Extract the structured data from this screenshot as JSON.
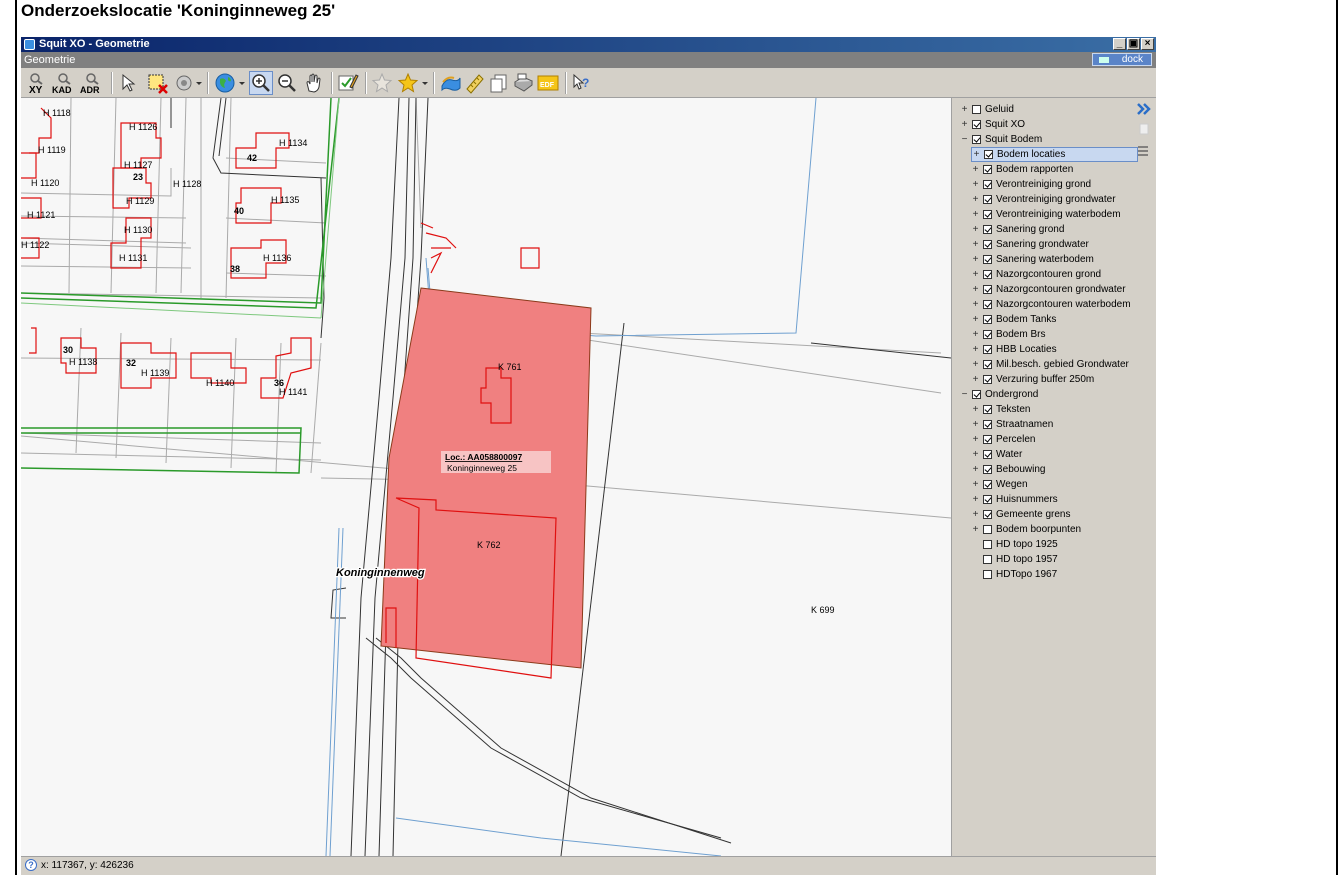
{
  "page": {
    "heading": "Onderzoekslocatie 'Koninginneweg 25'"
  },
  "window": {
    "title": "Squit XO - Geometrie",
    "subtitle": "Geometrie",
    "dock_label": "dock",
    "controls": [
      "_",
      "&#9633;",
      "X"
    ]
  },
  "toolbar": {
    "xy": "XY",
    "kad": "KAD",
    "adr": "ADR",
    "edf": "EDF"
  },
  "map": {
    "labels": {
      "h1118": "H 1118",
      "h1126": "H 1126",
      "h1119": "H 1119",
      "h1127": "H 1127",
      "h1120": "H 1120",
      "h1128": "H 1128",
      "h1129": "H 1129",
      "h1121": "H 1121",
      "h1130": "H 1130",
      "h1122": "H 1122",
      "h1131": "H 1131",
      "h1134": "H 1134",
      "h1135": "H 1135",
      "h1136": "H 1136",
      "h1138": "H 1138",
      "h1139": "H 1139",
      "h1140": "H 1140",
      "h1141": "H 1141",
      "n23": "23",
      "n42": "42",
      "n40": "40",
      "n38": "38",
      "n30": "30",
      "n32": "32",
      "n36": "36",
      "k761": "K 761",
      "k762": "K 762",
      "k699": "K 699",
      "loc": "Loc.: AA058800097",
      "addr": "Koninginneweg 25",
      "street": "Koninginnenweg"
    }
  },
  "layers": [
    {
      "label": "Geluid",
      "checked": false,
      "expander": "+",
      "indent": 0
    },
    {
      "label": "Squit XO",
      "checked": true,
      "expander": "+",
      "indent": 0
    },
    {
      "label": "Squit Bodem",
      "checked": true,
      "expander": "−",
      "indent": 0
    },
    {
      "label": "Bodem locaties",
      "checked": true,
      "expander": "+",
      "indent": 1,
      "selected": true
    },
    {
      "label": "Bodem rapporten",
      "checked": true,
      "expander": "+",
      "indent": 1
    },
    {
      "label": "Verontreiniging grond",
      "checked": true,
      "expander": "+",
      "indent": 1
    },
    {
      "label": "Verontreiniging grondwater",
      "checked": true,
      "expander": "+",
      "indent": 1
    },
    {
      "label": "Verontreiniging waterbodem",
      "checked": true,
      "expander": "+",
      "indent": 1
    },
    {
      "label": "Sanering grond",
      "checked": true,
      "expander": "+",
      "indent": 1
    },
    {
      "label": "Sanering grondwater",
      "checked": true,
      "expander": "+",
      "indent": 1
    },
    {
      "label": "Sanering waterbodem",
      "checked": true,
      "expander": "+",
      "indent": 1
    },
    {
      "label": "Nazorgcontouren grond",
      "checked": true,
      "expander": "+",
      "indent": 1
    },
    {
      "label": "Nazorgcontouren grondwater",
      "checked": true,
      "expander": "+",
      "indent": 1
    },
    {
      "label": "Nazorgcontouren waterbodem",
      "checked": true,
      "expander": "+",
      "indent": 1
    },
    {
      "label": "Bodem Tanks",
      "checked": true,
      "expander": "+",
      "indent": 1
    },
    {
      "label": "Bodem Brs",
      "checked": true,
      "expander": "+",
      "indent": 1
    },
    {
      "label": "HBB Locaties",
      "checked": true,
      "expander": "+",
      "indent": 1
    },
    {
      "label": "Mil.besch. gebied Grondwater",
      "checked": true,
      "expander": "+",
      "indent": 1
    },
    {
      "label": "Verzuring buffer 250m",
      "checked": true,
      "expander": "+",
      "indent": 1
    },
    {
      "label": "Ondergrond",
      "checked": true,
      "expander": "−",
      "indent": 0
    },
    {
      "label": "Teksten",
      "checked": true,
      "expander": "+",
      "indent": 1
    },
    {
      "label": "Straatnamen",
      "checked": true,
      "expander": "+",
      "indent": 1
    },
    {
      "label": "Percelen",
      "checked": true,
      "expander": "+",
      "indent": 1
    },
    {
      "label": "Water",
      "checked": true,
      "expander": "+",
      "indent": 1
    },
    {
      "label": "Bebouwing",
      "checked": true,
      "expander": "+",
      "indent": 1
    },
    {
      "label": "Wegen",
      "checked": true,
      "expander": "+",
      "indent": 1
    },
    {
      "label": "Huisnummers",
      "checked": true,
      "expander": "+",
      "indent": 1
    },
    {
      "label": "Gemeente grens",
      "checked": true,
      "expander": "+",
      "indent": 1
    },
    {
      "label": "Bodem boorpunten",
      "checked": false,
      "expander": "+",
      "indent": 1
    },
    {
      "label": "HD topo 1925",
      "checked": false,
      "expander": "",
      "indent": 1
    },
    {
      "label": "HD topo 1957",
      "checked": false,
      "expander": "",
      "indent": 1
    },
    {
      "label": "HDTopo 1967",
      "checked": false,
      "expander": "",
      "indent": 1
    }
  ],
  "status": {
    "coords": "x: 117367, y: 426236"
  }
}
